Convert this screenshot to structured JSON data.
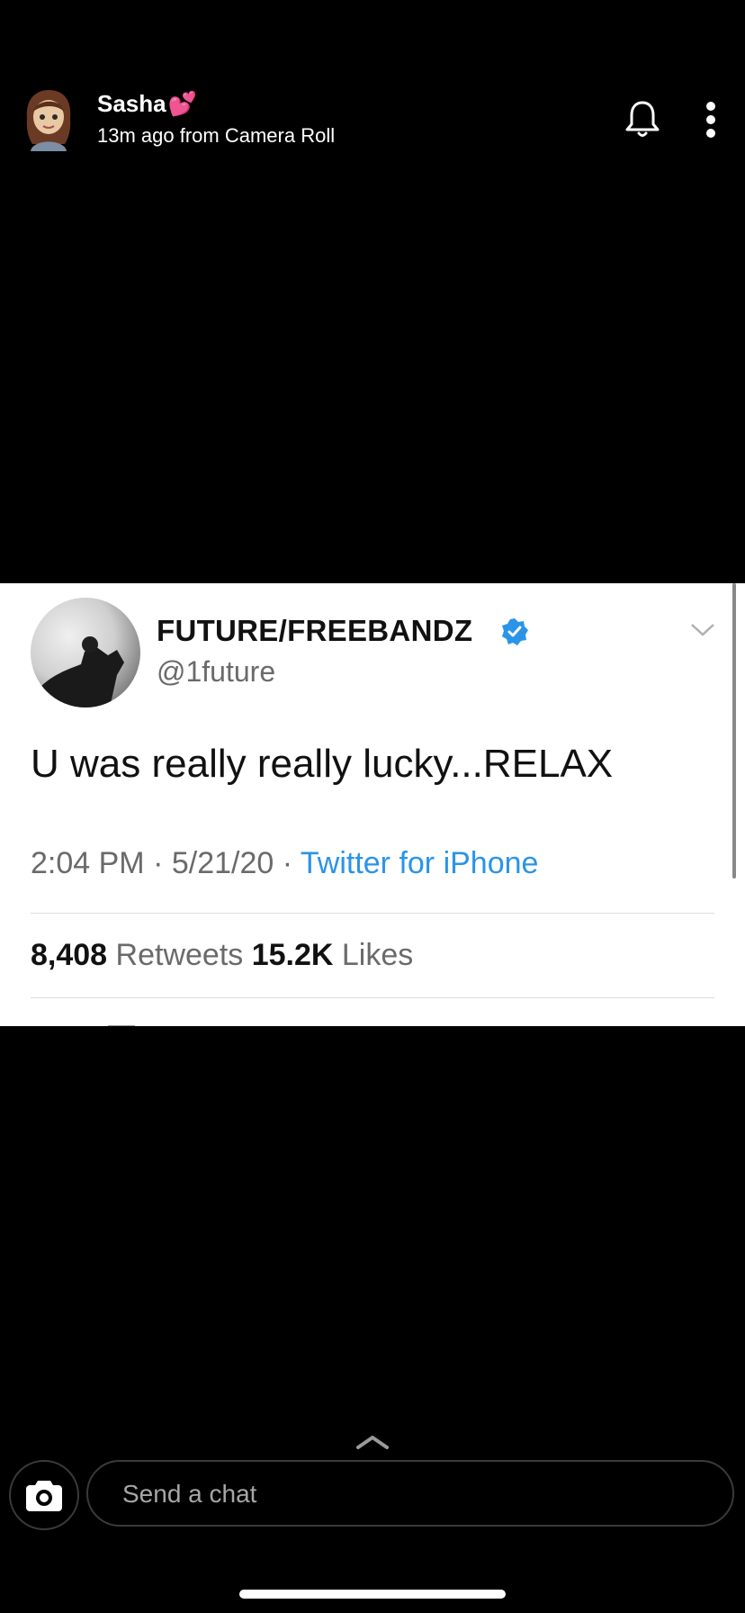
{
  "header": {
    "user_name": "Sasha",
    "name_emoji": "💕",
    "subtitle": "13m ago from Camera Roll",
    "bell_icon": "bell-icon",
    "more_icon": "more-vertical-icon"
  },
  "tweet": {
    "display_name": "FUTURE/FREEBANDZ",
    "handle": "@1future",
    "text": "U was really really lucky...RELAX",
    "time": "2:04 PM · 5/21/20 · ",
    "source": "Twitter for iPhone",
    "retweets_count": "8,408",
    "retweets_label": " Retweets ",
    "likes_count": "15.2K",
    "likes_label": " Likes",
    "verified_color": "#2a94e8"
  },
  "footer": {
    "chat_placeholder": "Send a chat",
    "camera_icon": "camera-icon",
    "swipe_icon": "chevron-up-icon"
  }
}
